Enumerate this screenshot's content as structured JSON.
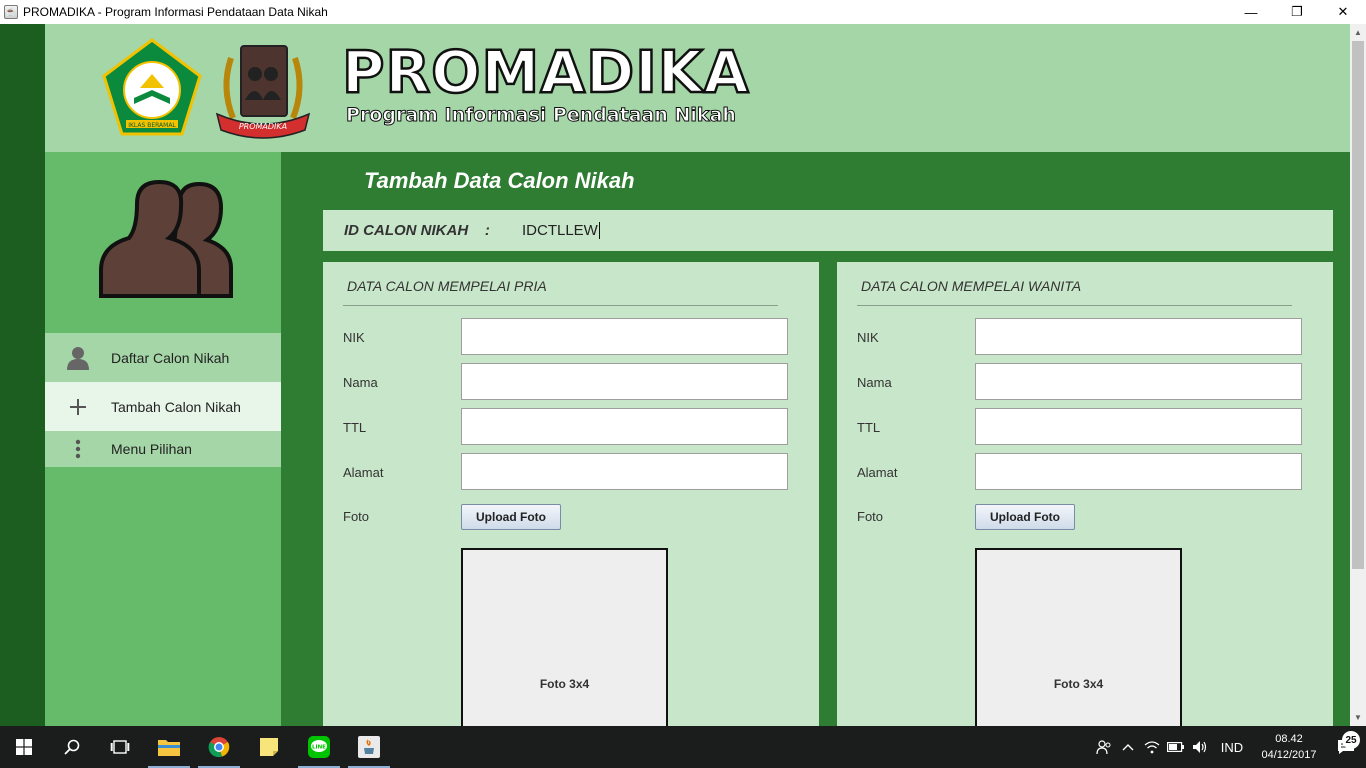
{
  "window": {
    "title": "PROMADIKA - Program Informasi Pendataan Data Nikah",
    "minimize": "—",
    "maximize": "❐",
    "close": "✕"
  },
  "brand": {
    "title": "PROMADIKA",
    "subtitle": "Program Informasi Pendataan Nikah",
    "logo_left": "kemenag-logo",
    "logo_right": "promadika-logo",
    "logo_left_caption": "IKLAS BERAMAL",
    "logo_right_caption": "PROMADIKA"
  },
  "sidebar": {
    "items": [
      {
        "label": "Daftar Calon Nikah",
        "icon": "person-icon"
      },
      {
        "label": "Tambah Calon Nikah",
        "icon": "plus-icon"
      },
      {
        "label": "Menu Pilihan",
        "icon": "more-vertical-icon"
      }
    ]
  },
  "main": {
    "title": "Tambah Data Calon Nikah",
    "id_label": "ID CALON NIKAH",
    "id_separator": ":",
    "id_value": "IDCTLLEW"
  },
  "pria": {
    "title": "DATA CALON MEMPELAI PRIA",
    "nik_label": "NIK",
    "nik_value": "",
    "nama_label": "Nama",
    "nama_value": "",
    "ttl_label": "TTL",
    "ttl_value": "",
    "alamat_label": "Alamat",
    "alamat_value": "",
    "foto_label": "Foto",
    "upload_label": "Upload Foto",
    "photo_placeholder": "Foto 3x4"
  },
  "wanita": {
    "title": "DATA CALON MEMPELAI WANITA",
    "nik_label": "NIK",
    "nik_value": "",
    "nama_label": "Nama",
    "nama_value": "",
    "ttl_label": "TTL",
    "ttl_value": "",
    "alamat_label": "Alamat",
    "alamat_value": "",
    "foto_label": "Foto",
    "upload_label": "Upload Foto",
    "photo_placeholder": "Foto 3x4"
  },
  "taskbar": {
    "language": "IND",
    "time": "08.42",
    "date": "04/12/2017",
    "notifications": "25"
  },
  "colors": {
    "dark_green": "#1b5e20",
    "header_green": "#a5d6a7",
    "sidebar_green": "#66bb6a",
    "main_green": "#2e7d32",
    "panel_green": "#c8e6c9"
  }
}
